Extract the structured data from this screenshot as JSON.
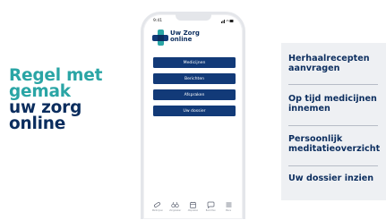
{
  "headline": {
    "line1": "Regel met",
    "line2": "gemak",
    "line3": "uw zorg",
    "line4": "online"
  },
  "colors": {
    "teal": "#2aa5a5",
    "navy": "#0b2d5e",
    "button": "#123a78",
    "panel": "#eef0f3"
  },
  "phone": {
    "time": "9:41",
    "status_icons": "signal-wifi-battery",
    "brand_line1": "Uw Zorg",
    "brand_line2": "online",
    "menu": [
      {
        "label": "Medicijnen"
      },
      {
        "label": "Berichten"
      },
      {
        "label": "Afspraken"
      },
      {
        "label": "Uw dossier"
      }
    ],
    "tabs": [
      {
        "icon": "pill-icon",
        "label": "Medicijnen"
      },
      {
        "icon": "binoculars-icon",
        "label": "Zorgzoeker"
      },
      {
        "icon": "calendar-icon",
        "label": "Afspraken"
      },
      {
        "icon": "message-icon",
        "label": "Berichten"
      },
      {
        "icon": "menu-icon",
        "label": "Menu"
      }
    ]
  },
  "features": [
    {
      "label": "Herhaalrecepten aanvragen"
    },
    {
      "label": "Op tijd medicijnen innemen"
    },
    {
      "label": "Persoonlijk meditatieoverzicht"
    },
    {
      "label": "Uw dossier inzien"
    }
  ]
}
